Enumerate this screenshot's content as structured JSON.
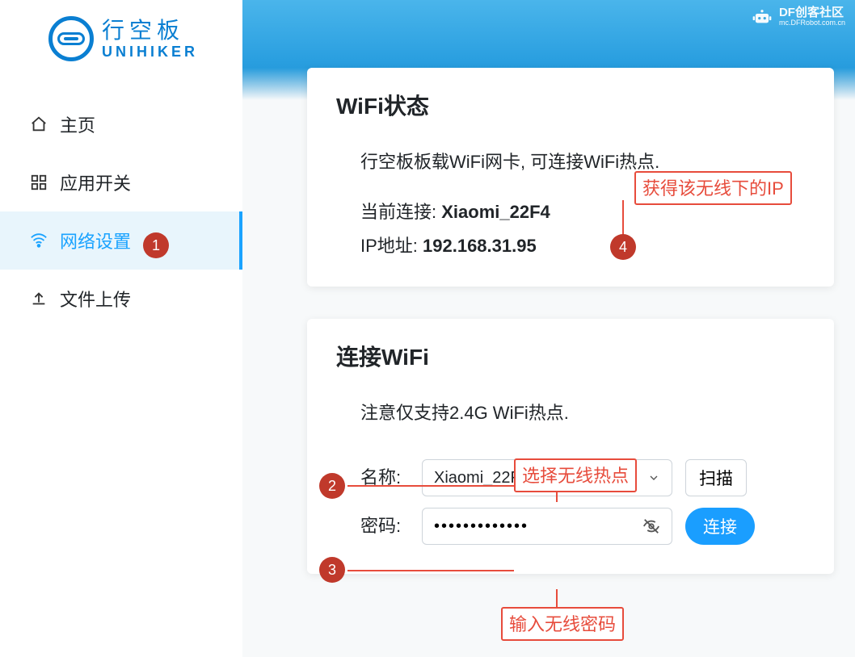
{
  "brand": {
    "cn": "行空板",
    "en": "UNIHIKER"
  },
  "watermark": {
    "title": "DF创客社区",
    "sub": "mc.DFRobot.com.cn"
  },
  "sidebar": {
    "items": [
      {
        "label": "主页",
        "icon": "home-icon",
        "active": false
      },
      {
        "label": "应用开关",
        "icon": "apps-icon",
        "active": false
      },
      {
        "label": "网络设置",
        "icon": "wifi-icon",
        "active": true
      },
      {
        "label": "文件上传",
        "icon": "upload-icon",
        "active": false
      }
    ]
  },
  "wifi_status": {
    "title": "WiFi状态",
    "description": "行空板板载WiFi网卡, 可连接WiFi热点.",
    "current_label": "当前连接: ",
    "current_value": "Xiaomi_22F4",
    "ip_label": "IP地址: ",
    "ip_value": "192.168.31.95"
  },
  "connect_wifi": {
    "title": "连接WiFi",
    "note": "注意仅支持2.4G WiFi热点.",
    "name_label": "名称:",
    "ssid_selected": "Xiaomi_22F4",
    "scan_button": "扫描",
    "password_label": "密码:",
    "password_masked": "•••••••••••••",
    "connect_button": "连接"
  },
  "annotations": {
    "b1": "1",
    "b2": "2",
    "b3": "3",
    "b4": "4",
    "tip_ip": "获得该无线下的IP",
    "tip_ssid": "选择无线热点",
    "tip_pwd": "输入无线密码"
  }
}
